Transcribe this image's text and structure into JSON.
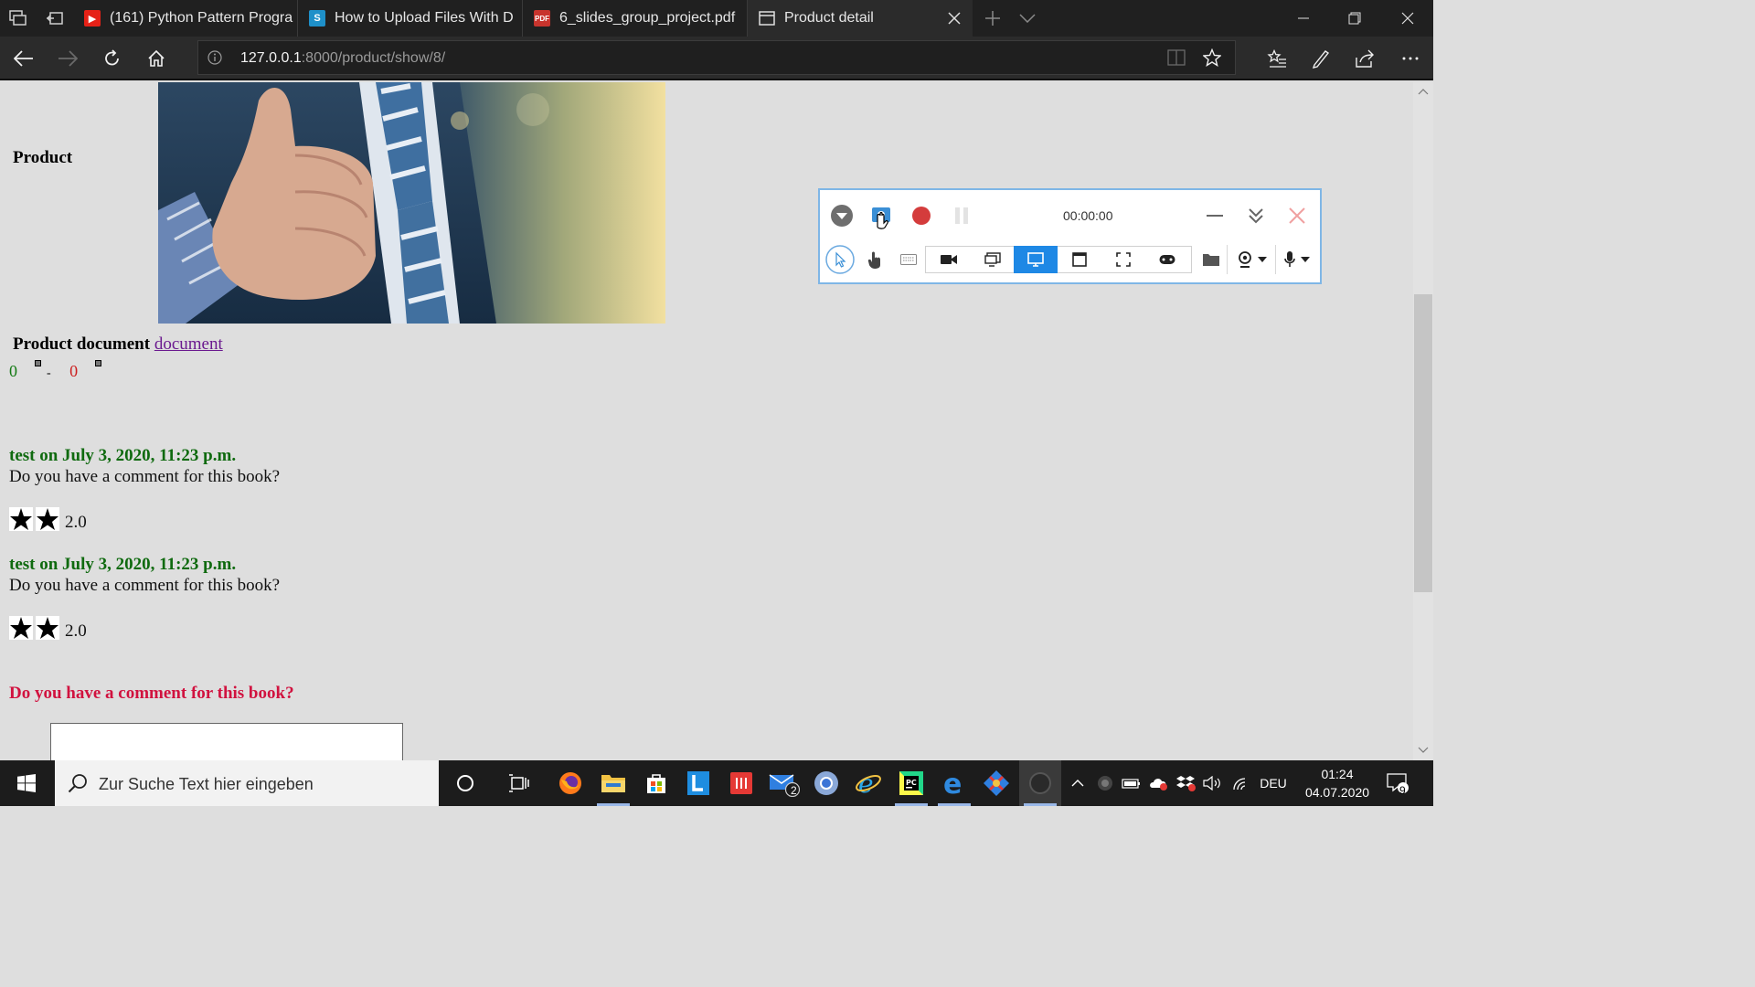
{
  "browser": {
    "tabs": [
      {
        "title": "(161) Python Pattern Progra",
        "icon": "youtube-icon"
      },
      {
        "title": "How to Upload Files With D",
        "icon": "s-site-icon"
      },
      {
        "title": "6_slides_group_project.pdf",
        "icon": "pdf-icon"
      },
      {
        "title": "Product detail",
        "icon": "page-icon"
      }
    ],
    "address": {
      "host": "127.0.0.1",
      "rest": ":8000/product/show/8/"
    }
  },
  "page": {
    "product_label": "Product",
    "document_label": "Product document",
    "document_link": "document",
    "votes": {
      "up": "0",
      "sep": "-",
      "down": "0"
    },
    "comments": [
      {
        "author_line": "test on July 3, 2020, 11:23 p.m.",
        "text": "Do you have a comment for this book?",
        "stars": 2,
        "rating": "2.0"
      },
      {
        "author_line": "test on July 3, 2020, 11:23 p.m.",
        "text": "Do you have a comment for this book?",
        "stars": 2,
        "rating": "2.0"
      }
    ],
    "form_title": "Do you have a comment for this book?"
  },
  "recorder": {
    "time": "00:00:00",
    "record_color": "#d43c3c",
    "active_mode": "screen-mode"
  },
  "taskbar": {
    "search_placeholder": "Zur Suche Text hier eingeben",
    "mail_badge": "2",
    "language": "DEU",
    "time": "01:24",
    "date": "04.07.2020",
    "notifications": "9"
  }
}
